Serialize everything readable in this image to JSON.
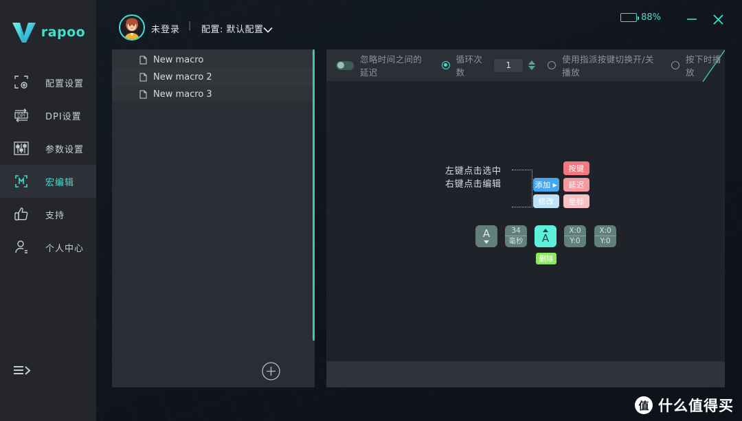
{
  "brand": {
    "logo_text": "rapoo",
    "logo_icon": "rapoo-v-logo-icon"
  },
  "sidebar": {
    "items": [
      {
        "label": "配置设置",
        "icon": "config-settings-icon",
        "active": false
      },
      {
        "label": "DPI设置",
        "icon": "dpi-settings-icon",
        "active": false
      },
      {
        "label": "参数设置",
        "icon": "parameter-sliders-icon",
        "active": false
      },
      {
        "label": "宏编辑",
        "icon": "macro-edit-icon",
        "active": true
      },
      {
        "label": "支持",
        "icon": "thumbs-up-icon",
        "active": false
      },
      {
        "label": "个人中心",
        "icon": "user-profile-icon",
        "active": false
      }
    ],
    "collapse_icon": "collapse-menu-icon"
  },
  "header": {
    "avatar_icon": "user-avatar",
    "login_status": "未登录",
    "separator": "|",
    "profile_label": "配置: 默认配置",
    "caret_icon": "chevron-down-icon",
    "battery_percent": "88%",
    "battery_level": 88,
    "battery_icon": "battery-icon",
    "minimize_icon": "minimize-icon",
    "close_icon": "close-icon"
  },
  "macro_panel": {
    "items": [
      {
        "label": "New macro",
        "icon": "macro-file-icon"
      },
      {
        "label": "New macro 2",
        "icon": "macro-file-icon"
      },
      {
        "label": "New macro 3",
        "icon": "macro-file-icon"
      }
    ],
    "add_button_icon": "add-macro-plus-icon",
    "scrollbar_color": "#3fc8ae"
  },
  "toolbar": {
    "ignore_delay_label": "忽略时间之间的延迟",
    "ignore_delay_on": false,
    "loop_count_label": "循环次数",
    "loop_count_selected": true,
    "loop_count_value": "1",
    "spinner_icon": "stepper-up-down-icon",
    "toggle_play_label": "使用指派按键切换开/关播放",
    "toggle_play_selected": false,
    "press_play_label": "按下时播放",
    "press_play_selected": false
  },
  "hint": {
    "line1": "左键点击选中",
    "line2": "右键点击编辑",
    "buttons": [
      {
        "label": "添加",
        "style": "blue",
        "has_arrow": true
      },
      {
        "label": "修改",
        "style": "blue2",
        "has_arrow": false
      }
    ],
    "types": [
      {
        "label": "按键",
        "style": "red"
      },
      {
        "label": "延迟",
        "style": "red2"
      },
      {
        "label": "坐标",
        "style": "red3"
      }
    ]
  },
  "sequence": {
    "cards": [
      {
        "kind": "key-up",
        "letter": "A",
        "sub": "",
        "selected": false
      },
      {
        "kind": "delay",
        "top": "34",
        "bottom": "毫秒",
        "selected": false
      },
      {
        "kind": "key-down",
        "letter": "A",
        "sub": "",
        "selected": true
      },
      {
        "kind": "coord",
        "top": "X:0",
        "bottom": "Y:0",
        "selected": false
      },
      {
        "kind": "coord",
        "top": "X:0",
        "bottom": "Y:0",
        "selected": false
      }
    ],
    "delete_label": "删除"
  },
  "watermark": {
    "badge": "值",
    "text": "什么值得买"
  },
  "colors": {
    "accent": "#3fe0d0",
    "sidebar_bg": "#24262c",
    "panel_bg": "#2a2d33",
    "editor_bg": "#1f2228",
    "selected_card": "#5ff0dc",
    "delete_green": "#8fe863"
  }
}
